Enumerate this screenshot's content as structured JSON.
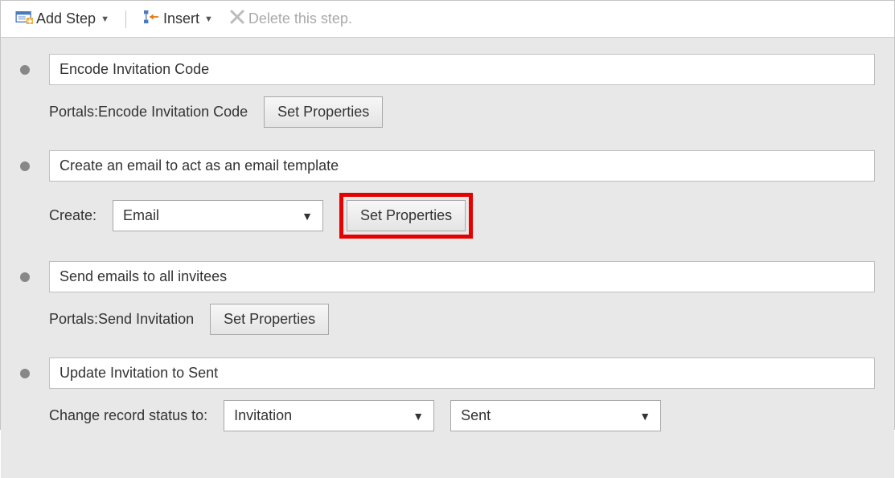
{
  "toolbar": {
    "add_step_label": "Add Step",
    "insert_label": "Insert",
    "delete_label": "Delete this step."
  },
  "steps": {
    "0": {
      "title": "Encode Invitation Code",
      "detail_label": "Portals:Encode Invitation Code",
      "button": "Set Properties"
    },
    "1": {
      "title": "Create an email to act as an email template",
      "create_label": "Create:",
      "create_value": "Email",
      "button": "Set Properties"
    },
    "2": {
      "title": "Send emails to all invitees",
      "detail_label": "Portals:Send Invitation",
      "button": "Set Properties"
    },
    "3": {
      "title": "Update Invitation to Sent",
      "change_label": "Change record status to:",
      "entity_value": "Invitation",
      "status_value": "Sent"
    }
  }
}
